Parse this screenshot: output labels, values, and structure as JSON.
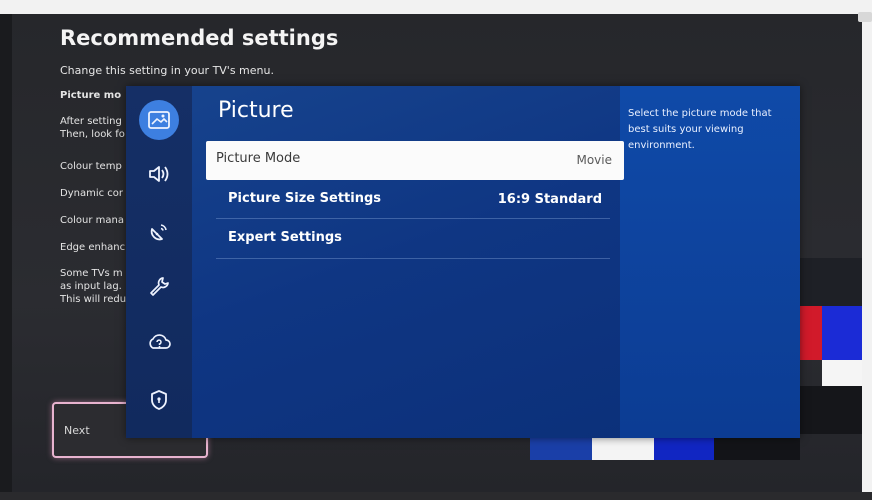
{
  "background_screen": {
    "title": "Recommended settings",
    "subtitle": "Change this setting in your TV's menu.",
    "lines": [
      "Picture mo",
      "After setting",
      "Then, look fo",
      "Colour temp",
      "Dynamic cor",
      "Colour mana",
      "Edge enhanc",
      "Some TVs m",
      "as input lag.",
      "This will redu"
    ],
    "next_button_label": "Next"
  },
  "menu": {
    "title": "Picture",
    "sidebar_icons": [
      "picture-icon",
      "sound-icon",
      "broadcasting-icon",
      "general-icon",
      "support-icon",
      "privacy-shield-icon"
    ],
    "active_icon_index": 0,
    "items": [
      {
        "label": "Picture Mode",
        "value": "Movie",
        "selected": true
      },
      {
        "label": "Picture Size Settings",
        "value": "16:9 Standard",
        "selected": false
      },
      {
        "label": "Expert Settings",
        "value": "",
        "selected": false
      }
    ],
    "help_text": "Select the picture mode that best suits your viewing environment."
  },
  "colors": {
    "menu_blue": "#0f3683",
    "sidebar": "#112a5e",
    "active_icon": "#3d7fe0",
    "selected_row": "#fbfbfb",
    "next_button_border": "#e8b3cf"
  }
}
